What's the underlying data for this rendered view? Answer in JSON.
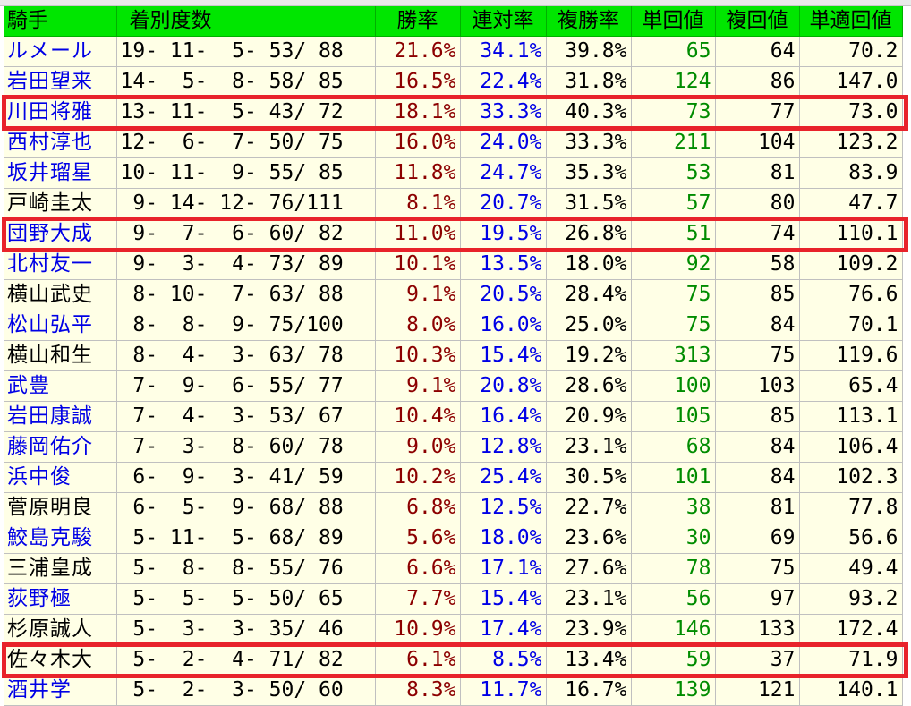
{
  "colors": {
    "header_bg": "#00e600",
    "row_bg": "#ffffe6",
    "name_link": "#0000e6",
    "win_rate": "#8c0000",
    "rentai_rate": "#0000e6",
    "tan_kaishu": "#008c00",
    "highlight_border": "#e8232b"
  },
  "headers": [
    "騎手",
    "着別度数",
    "勝率",
    "連対率",
    "複勝率",
    "単回値",
    "複回値",
    "単適回値"
  ],
  "rows": [
    {
      "name": "ルメール",
      "link": true,
      "record": "19- 11-  5- 53/ 88",
      "win": "21.6%",
      "ren": "34.1%",
      "fuku": "39.8%",
      "tan": "65",
      "fukuk": "64",
      "teki": "70.2"
    },
    {
      "name": "岩田望来",
      "link": true,
      "record": "14-  5-  8- 58/ 85",
      "win": "16.5%",
      "ren": "22.4%",
      "fuku": "31.8%",
      "tan": "124",
      "fukuk": "86",
      "teki": "147.0"
    },
    {
      "name": "川田将雅",
      "link": true,
      "record": "13- 11-  5- 43/ 72",
      "win": "18.1%",
      "ren": "33.3%",
      "fuku": "40.3%",
      "tan": "73",
      "fukuk": "77",
      "teki": "73.0"
    },
    {
      "name": "西村淳也",
      "link": true,
      "record": "12-  6-  7- 50/ 75",
      "win": "16.0%",
      "ren": "24.0%",
      "fuku": "33.3%",
      "tan": "211",
      "fukuk": "104",
      "teki": "123.2"
    },
    {
      "name": "坂井瑠星",
      "link": true,
      "record": "10- 11-  9- 55/ 85",
      "win": "11.8%",
      "ren": "24.7%",
      "fuku": "35.3%",
      "tan": "53",
      "fukuk": "81",
      "teki": "83.9"
    },
    {
      "name": "戸崎圭太",
      "link": false,
      "record": " 9- 14- 12- 76/111",
      "win": "8.1%",
      "ren": "20.7%",
      "fuku": "31.5%",
      "tan": "57",
      "fukuk": "80",
      "teki": "47.7"
    },
    {
      "name": "団野大成",
      "link": true,
      "record": " 9-  7-  6- 60/ 82",
      "win": "11.0%",
      "ren": "19.5%",
      "fuku": "26.8%",
      "tan": "51",
      "fukuk": "74",
      "teki": "110.1"
    },
    {
      "name": "北村友一",
      "link": true,
      "record": " 9-  3-  4- 73/ 89",
      "win": "10.1%",
      "ren": "13.5%",
      "fuku": "18.0%",
      "tan": "92",
      "fukuk": "58",
      "teki": "109.2"
    },
    {
      "name": "横山武史",
      "link": false,
      "record": " 8- 10-  7- 63/ 88",
      "win": "9.1%",
      "ren": "20.5%",
      "fuku": "28.4%",
      "tan": "75",
      "fukuk": "85",
      "teki": "76.6"
    },
    {
      "name": "松山弘平",
      "link": true,
      "record": " 8-  8-  9- 75/100",
      "win": "8.0%",
      "ren": "16.0%",
      "fuku": "25.0%",
      "tan": "75",
      "fukuk": "84",
      "teki": "70.1"
    },
    {
      "name": "横山和生",
      "link": false,
      "record": " 8-  4-  3- 63/ 78",
      "win": "10.3%",
      "ren": "15.4%",
      "fuku": "19.2%",
      "tan": "313",
      "fukuk": "75",
      "teki": "119.6"
    },
    {
      "name": "武豊",
      "link": true,
      "record": " 7-  9-  6- 55/ 77",
      "win": "9.1%",
      "ren": "20.8%",
      "fuku": "28.6%",
      "tan": "100",
      "fukuk": "103",
      "teki": "65.4"
    },
    {
      "name": "岩田康誠",
      "link": true,
      "record": " 7-  4-  3- 53/ 67",
      "win": "10.4%",
      "ren": "16.4%",
      "fuku": "20.9%",
      "tan": "105",
      "fukuk": "85",
      "teki": "113.1"
    },
    {
      "name": "藤岡佑介",
      "link": true,
      "record": " 7-  3-  8- 60/ 78",
      "win": "9.0%",
      "ren": "12.8%",
      "fuku": "23.1%",
      "tan": "68",
      "fukuk": "84",
      "teki": "106.4"
    },
    {
      "name": "浜中俊",
      "link": true,
      "record": " 6-  9-  3- 41/ 59",
      "win": "10.2%",
      "ren": "25.4%",
      "fuku": "30.5%",
      "tan": "101",
      "fukuk": "84",
      "teki": "102.3"
    },
    {
      "name": "菅原明良",
      "link": false,
      "record": " 6-  5-  9- 68/ 88",
      "win": "6.8%",
      "ren": "12.5%",
      "fuku": "22.7%",
      "tan": "38",
      "fukuk": "81",
      "teki": "77.8"
    },
    {
      "name": "鮫島克駿",
      "link": true,
      "record": " 5- 11-  5- 68/ 89",
      "win": "5.6%",
      "ren": "18.0%",
      "fuku": "23.6%",
      "tan": "30",
      "fukuk": "69",
      "teki": "56.6"
    },
    {
      "name": "三浦皇成",
      "link": false,
      "record": " 5-  8-  8- 55/ 76",
      "win": "6.6%",
      "ren": "17.1%",
      "fuku": "27.6%",
      "tan": "78",
      "fukuk": "75",
      "teki": "49.4"
    },
    {
      "name": "荻野極",
      "link": true,
      "record": " 5-  5-  5- 50/ 65",
      "win": "7.7%",
      "ren": "15.4%",
      "fuku": "23.1%",
      "tan": "56",
      "fukuk": "97",
      "teki": "93.2"
    },
    {
      "name": "杉原誠人",
      "link": false,
      "record": " 5-  3-  3- 35/ 46",
      "win": "10.9%",
      "ren": "17.4%",
      "fuku": "23.9%",
      "tan": "146",
      "fukuk": "133",
      "teki": "172.4"
    },
    {
      "name": "佐々木大",
      "link": false,
      "record": " 5-  2-  4- 71/ 82",
      "win": "6.1%",
      "ren": "8.5%",
      "fuku": "13.4%",
      "tan": "59",
      "fukuk": "37",
      "teki": "71.9"
    },
    {
      "name": "酒井学",
      "link": true,
      "record": " 5-  2-  3- 50/ 60",
      "win": "8.3%",
      "ren": "11.7%",
      "fuku": "16.7%",
      "tan": "139",
      "fukuk": "121",
      "teki": "140.1"
    }
  ],
  "highlighted_rows": [
    "川田将雅",
    "団野大成",
    "佐々木大"
  ]
}
